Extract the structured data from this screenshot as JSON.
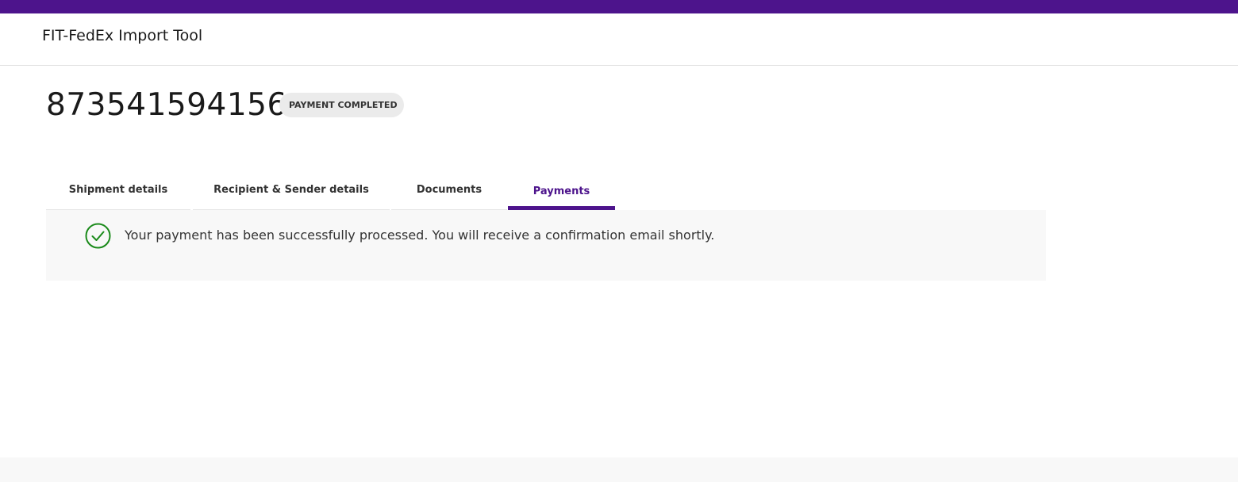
{
  "app": {
    "title": "FIT-FedEx Import Tool",
    "brand_color": "#4d148c"
  },
  "shipment": {
    "tracking_number": "873541594156",
    "status": "PAYMENT COMPLETED"
  },
  "tabs": [
    {
      "label": "Shipment details",
      "active": false
    },
    {
      "label": "Recipient & Sender details",
      "active": false
    },
    {
      "label": "Documents",
      "active": false
    },
    {
      "label": "Payments",
      "active": true
    }
  ],
  "notice": {
    "icon": "check-circle-icon",
    "icon_color": "#1a8a1a",
    "message": "Your payment has been successfully processed. You will receive a confirmation email shortly."
  }
}
